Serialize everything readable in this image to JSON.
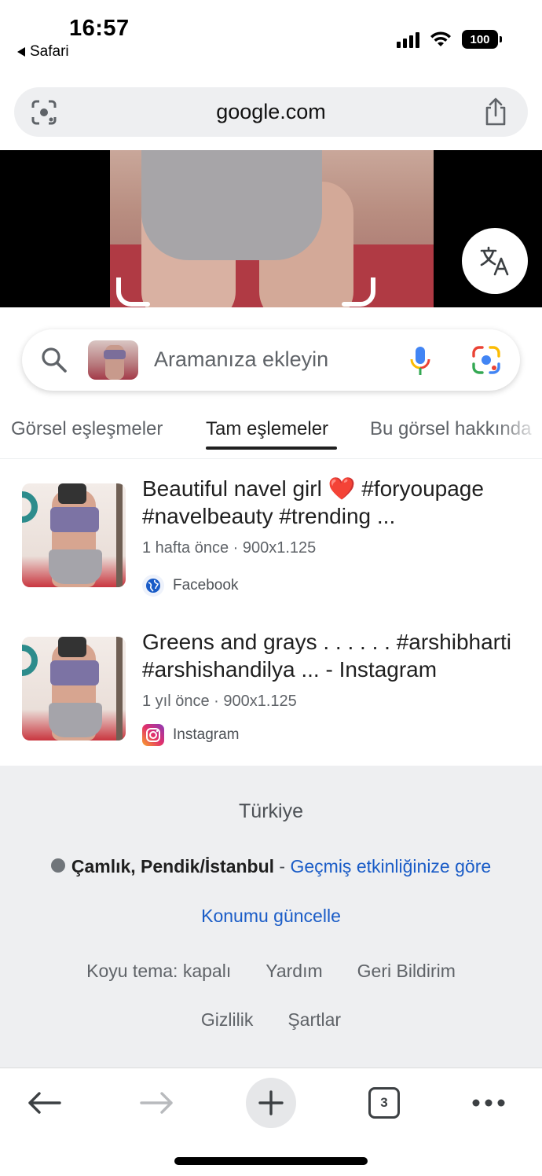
{
  "status": {
    "time": "16:57",
    "back_app": "Safari",
    "battery": "100"
  },
  "browser": {
    "url": "google.com"
  },
  "search": {
    "placeholder": "Aramanıza ekleyin"
  },
  "tabs": [
    {
      "label": "Görsel eşleşmeler",
      "active": false
    },
    {
      "label": "Tam eşlemeler",
      "active": true
    },
    {
      "label": "Bu görsel hakkında",
      "active": false
    }
  ],
  "results": [
    {
      "title": "Beautiful navel girl",
      "title_emoji": "❤️",
      "title_rest": "#foryoupage #navelbeauty #trending ...",
      "meta": "1 hafta önce · 900x1.125",
      "source": "Facebook",
      "source_icon": "globe-icon"
    },
    {
      "title": "Greens and grays . . . . . . #arshibharti #arshishandilya ... - Instagram",
      "meta": "1 yıl önce · 900x1.125",
      "source": "Instagram",
      "source_icon": "instagram-icon"
    }
  ],
  "footer": {
    "country": "Türkiye",
    "location": "Çamlık, Pendik/İstanbul",
    "location_sep": " - ",
    "location_basis": "Geçmiş etkinliğinize göre",
    "update_location": "Konumu güncelle",
    "links": [
      "Koyu tema: kapalı",
      "Yardım",
      "Geri Bildirim"
    ],
    "links2": [
      "Gizlilik",
      "Şartlar"
    ]
  },
  "toolbar": {
    "tab_count": "3"
  },
  "colors": {
    "link_blue": "#1a5cc7",
    "footer_bg": "#eeeff1",
    "google_blue": "#4285f4",
    "google_red": "#ea4335",
    "google_yellow": "#fbbc04",
    "google_green": "#34a853"
  }
}
